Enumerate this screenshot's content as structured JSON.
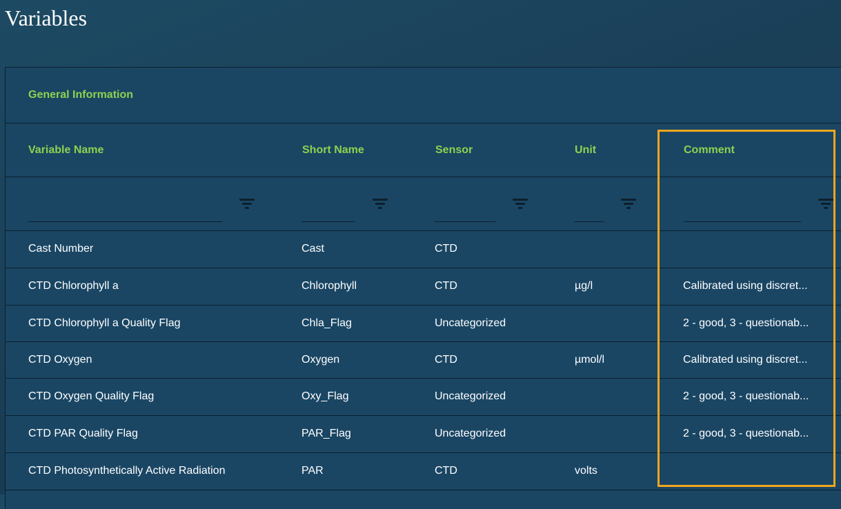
{
  "page": {
    "title": "Variables"
  },
  "section": {
    "label": "General Information"
  },
  "columns": [
    {
      "label": "Variable Name"
    },
    {
      "label": "Short Name"
    },
    {
      "label": "Sensor"
    },
    {
      "label": "Unit"
    },
    {
      "label": "Comment"
    }
  ],
  "filters": {
    "placeholder": ""
  },
  "rows": [
    {
      "variable_name": "Cast Number",
      "short_name": "Cast",
      "sensor": "CTD",
      "unit": "",
      "comment": ""
    },
    {
      "variable_name": "CTD Chlorophyll a",
      "short_name": "Chlorophyll",
      "sensor": "CTD",
      "unit": "µg/l",
      "comment": "Calibrated using discret..."
    },
    {
      "variable_name": "CTD Chlorophyll a Quality Flag",
      "short_name": "Chla_Flag",
      "sensor": "Uncategorized",
      "unit": "",
      "comment": "2 - good, 3 - questionab..."
    },
    {
      "variable_name": "CTD Oxygen",
      "short_name": "Oxygen",
      "sensor": "CTD",
      "unit": "µmol/l",
      "comment": "Calibrated using discret..."
    },
    {
      "variable_name": "CTD Oxygen Quality Flag",
      "short_name": "Oxy_Flag",
      "sensor": "Uncategorized",
      "unit": "",
      "comment": "2 - good, 3 - questionab..."
    },
    {
      "variable_name": "CTD PAR Quality Flag",
      "short_name": "PAR_Flag",
      "sensor": "Uncategorized",
      "unit": "",
      "comment": "2 - good, 3 - questionab..."
    },
    {
      "variable_name": "CTD Photosynthetically Active Radiation",
      "short_name": "PAR",
      "sensor": "CTD",
      "unit": "volts",
      "comment": ""
    }
  ],
  "icons": {
    "filter": "filter-icon"
  },
  "colors": {
    "accent_green": "#8fd14f",
    "highlight_orange": "#f4a61d",
    "panel_bg": "#1a4664",
    "border": "#0c1f2c"
  }
}
